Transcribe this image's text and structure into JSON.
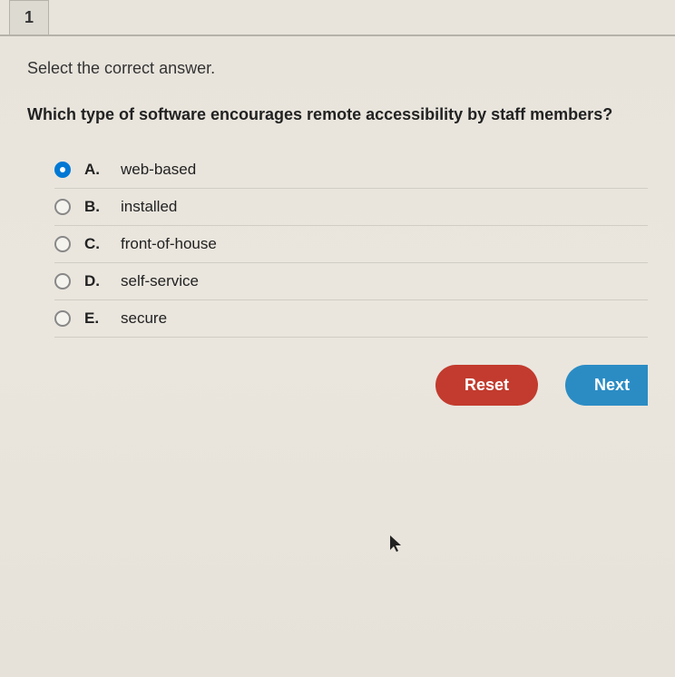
{
  "questionNumber": "1",
  "instruction": "Select the correct answer.",
  "question": "Which type of software encourages remote accessibility by staff members?",
  "options": [
    {
      "letter": "A.",
      "text": "web-based",
      "selected": true
    },
    {
      "letter": "B.",
      "text": "installed",
      "selected": false
    },
    {
      "letter": "C.",
      "text": "front-of-house",
      "selected": false
    },
    {
      "letter": "D.",
      "text": "self-service",
      "selected": false
    },
    {
      "letter": "E.",
      "text": "secure",
      "selected": false
    }
  ],
  "buttons": {
    "reset": "Reset",
    "next": "Next"
  }
}
